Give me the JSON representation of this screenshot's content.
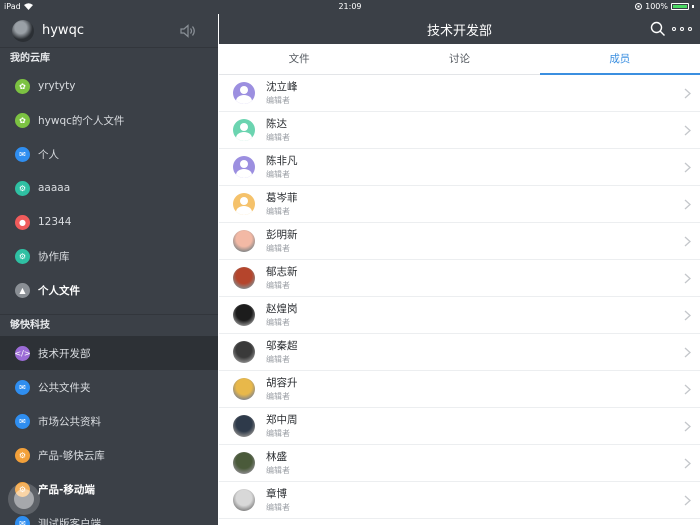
{
  "status_bar": {
    "device": "iPad",
    "time": "21:09",
    "battery": "100%"
  },
  "sidebar": {
    "username": "hywqc",
    "sections": [
      {
        "title": "我的云库",
        "items": [
          {
            "label": "yrytyty",
            "icon": "leaf-icon",
            "color": "#7cc242"
          },
          {
            "label": "hywqc的个人文件",
            "icon": "leaf-icon",
            "color": "#7cc242"
          },
          {
            "label": "个人",
            "icon": "mail-icon",
            "color": "#2f8ef0"
          },
          {
            "label": "aaaaa",
            "icon": "gear-icon",
            "color": "#2fc0a3"
          },
          {
            "label": "12344",
            "icon": "dog-icon",
            "color": "#f05b5b"
          },
          {
            "label": "协作库",
            "icon": "gear-icon",
            "color": "#2fc0a3"
          },
          {
            "label": "个人文件",
            "icon": "landscape-icon",
            "color": "#8a8f95"
          }
        ]
      },
      {
        "title": "够快科技",
        "items": [
          {
            "label": "技术开发部",
            "icon": "code-icon",
            "color": "#9b6bd6",
            "active": true
          },
          {
            "label": "公共文件夹",
            "icon": "mail-icon",
            "color": "#2f8ef0"
          },
          {
            "label": "市场公共资料",
            "icon": "mail-icon",
            "color": "#2f8ef0"
          },
          {
            "label": "产品-够快云库",
            "icon": "gear-icon",
            "color": "#f2a03a"
          },
          {
            "label": "产品-移动端",
            "icon": "gear-icon",
            "color": "#f2a03a"
          },
          {
            "label": "测试版客户端",
            "icon": "mail-icon",
            "color": "#2f8ef0"
          }
        ]
      }
    ]
  },
  "header": {
    "title": "技术开发部"
  },
  "tabs": [
    {
      "label": "文件",
      "active": false
    },
    {
      "label": "讨论",
      "active": false
    },
    {
      "label": "成员",
      "active": true
    }
  ],
  "members": [
    {
      "name": "沈立峰",
      "role": "编辑者",
      "avatar": "default-avatar",
      "color": "#9c8fe0"
    },
    {
      "name": "陈达",
      "role": "编辑者",
      "avatar": "default-avatar",
      "color": "#6bd4b0"
    },
    {
      "name": "陈非凡",
      "role": "编辑者",
      "avatar": "default-avatar",
      "color": "#9c8fe0"
    },
    {
      "name": "葛岑菲",
      "role": "编辑者",
      "avatar": "default-avatar",
      "color": "#f5c26b"
    },
    {
      "name": "彭明新",
      "role": "编辑者",
      "avatar": "cartoon-avatar",
      "color": "#f3b9a5"
    },
    {
      "name": "郁志新",
      "role": "编辑者",
      "avatar": "photo-avatar",
      "color": "#b5452c"
    },
    {
      "name": "赵煌岗",
      "role": "编辑者",
      "avatar": "photo-avatar",
      "color": "#1c1c1c"
    },
    {
      "name": "邬秦超",
      "role": "编辑者",
      "avatar": "photo-avatar",
      "color": "#3a3a3a"
    },
    {
      "name": "胡容升",
      "role": "编辑者",
      "avatar": "photo-avatar",
      "color": "#e8b84a"
    },
    {
      "name": "郑中周",
      "role": "编辑者",
      "avatar": "photo-avatar",
      "color": "#2e3a4a"
    },
    {
      "name": "林盛",
      "role": "编辑者",
      "avatar": "photo-avatar",
      "color": "#4a5a3a"
    },
    {
      "name": "章博",
      "role": "编辑者",
      "avatar": "photo-avatar",
      "color": "#d8d8d8"
    }
  ]
}
